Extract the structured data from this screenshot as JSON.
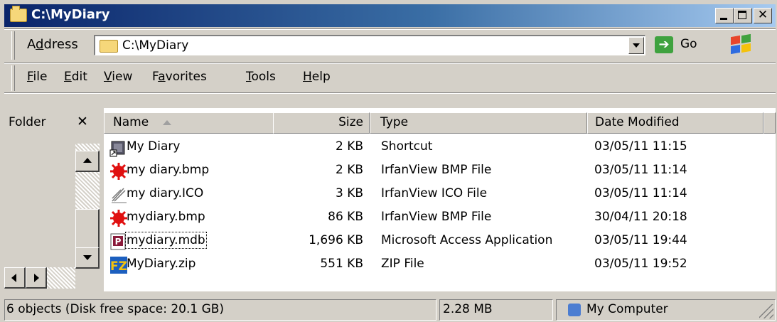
{
  "window": {
    "title": "C:\\MyDiary"
  },
  "address": {
    "label": "Address",
    "accesskey": "d",
    "path": "C:\\MyDiary",
    "go_label": "Go"
  },
  "menu": [
    {
      "label": "File",
      "accesskey": "F"
    },
    {
      "label": "Edit",
      "accesskey": "E"
    },
    {
      "label": "View",
      "accesskey": "V"
    },
    {
      "label": "Favorites",
      "accesskey": "a"
    },
    {
      "label": "Tools",
      "accesskey": "T"
    },
    {
      "label": "Help",
      "accesskey": "H"
    }
  ],
  "folder_pane": {
    "title": "Folder",
    "close_glyph": "✕"
  },
  "columns": {
    "name": "Name",
    "size": "Size",
    "type": "Type",
    "date": "Date Modified"
  },
  "files": [
    {
      "name": "My Diary",
      "size": "2 KB",
      "type": "Shortcut",
      "date": "03/05/11 11:15",
      "icon": "shortcut-icon"
    },
    {
      "name": "my diary.bmp",
      "size": "2 KB",
      "type": "IrfanView BMP File",
      "date": "03/05/11 11:14",
      "icon": "irfanview-icon"
    },
    {
      "name": "my diary.ICO",
      "size": "3 KB",
      "type": "IrfanView ICO File",
      "date": "03/05/11 11:14",
      "icon": "ico-file-icon"
    },
    {
      "name": "mydiary.bmp",
      "size": "86 KB",
      "type": "IrfanView BMP File",
      "date": "30/04/11 20:18",
      "icon": "irfanview-icon"
    },
    {
      "name": "mydiary.mdb",
      "size": "1,696 KB",
      "type": "Microsoft Access Application",
      "date": "03/05/11 19:44",
      "icon": "access-icon",
      "focused": true
    },
    {
      "name": "MyDiary.zip",
      "size": "551 KB",
      "type": "ZIP File",
      "date": "03/05/11 19:52",
      "icon": "filezilla-zip-icon"
    }
  ],
  "status": {
    "objects": "6 objects (Disk free space: 20.1 GB)",
    "size": "2.28 MB",
    "location": "My Computer"
  },
  "colors": {
    "title_start": "#0a246a",
    "title_end": "#a6caf0",
    "face": "#d4d0c8"
  }
}
